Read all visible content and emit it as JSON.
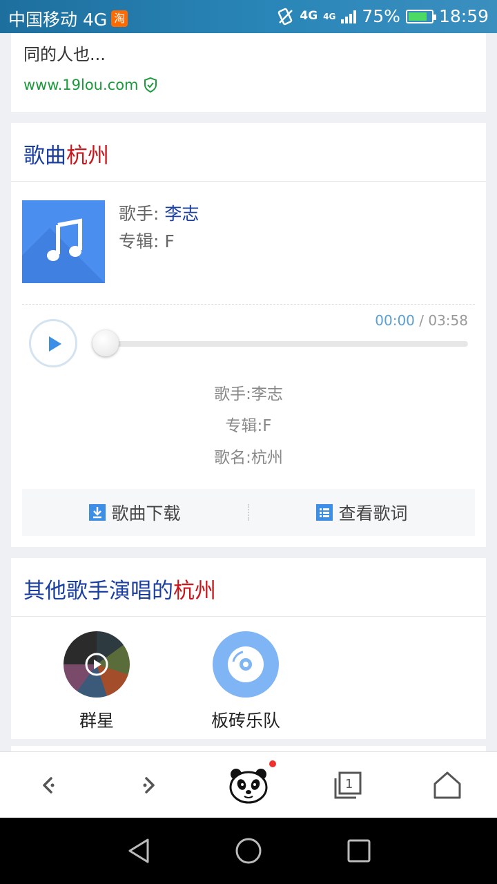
{
  "status_bar": {
    "carrier": "中国移动 4G",
    "taobao_badge": "淘",
    "net_4g": "4G",
    "net_4g_small": "4G",
    "battery_percent": "75%",
    "time": "18:59",
    "battery_level": 0.75
  },
  "top_result": {
    "snippet_partial": "同的人也...",
    "source": "www.19lou.com",
    "verified_icon": "shield-check-icon"
  },
  "song_card": {
    "title_prefix": "歌曲",
    "title_highlight": "杭州",
    "singer_label": "歌手: ",
    "singer_value": "李志",
    "album_label": "专辑: F",
    "time_current": "00:00",
    "time_sep": " / ",
    "time_total": "03:58",
    "info_singer": "歌手:李志",
    "info_album": "专辑:F",
    "info_song": "歌名:杭州",
    "download_label": "歌曲下载",
    "lyrics_label": "查看歌词",
    "accent_color": "#3d8ee6",
    "highlight_color": "#c8161d",
    "title_color": "#1a3fa0"
  },
  "other_singers": {
    "title_prefix": "其他歌手演唱的",
    "title_highlight": "杭州",
    "artists": [
      {
        "name": "群星"
      },
      {
        "name": "板砖乐队"
      }
    ]
  },
  "toolbar": {
    "back_icon": "chevron-left-icon",
    "forward_icon": "chevron-right-icon",
    "panda_icon": "panda-icon",
    "tabs_count": "1",
    "home_icon": "home-icon"
  },
  "navbar": {
    "back_icon": "triangle-back-icon",
    "home_icon": "circle-home-icon",
    "recent_icon": "square-recent-icon"
  }
}
